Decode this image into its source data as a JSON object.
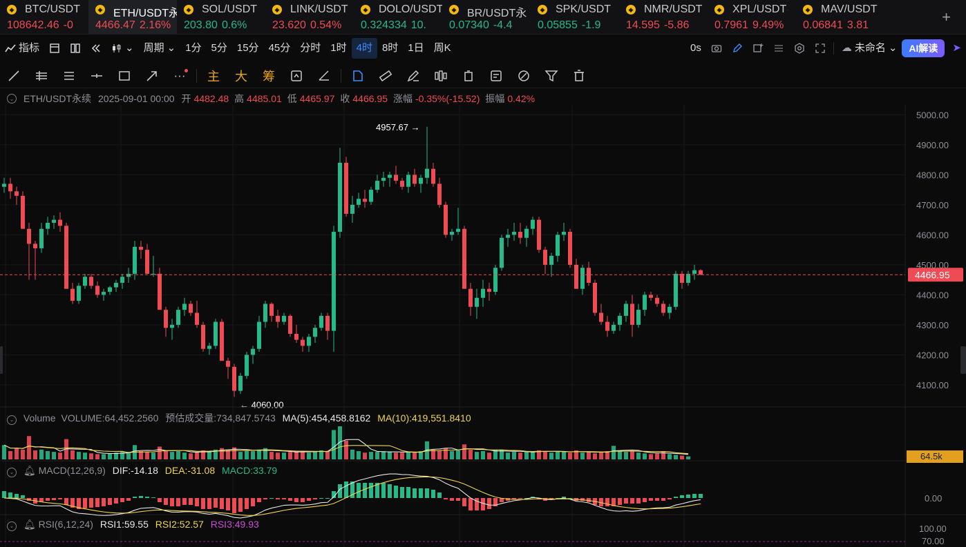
{
  "tickers": [
    {
      "symbol": "BTC/USDT",
      "price": "108642.46",
      "change": "-0",
      "dir": "dn",
      "active": false
    },
    {
      "symbol": "ETH/USDT永续",
      "price": "4466.47",
      "change": "2.16%",
      "dir": "dn",
      "active": true
    },
    {
      "symbol": "SOL/USDT",
      "price": "203.80",
      "change": "0.6%",
      "dir": "up",
      "active": false
    },
    {
      "symbol": "LINK/USDT",
      "price": "23.620",
      "change": "0.54%",
      "dir": "dn",
      "active": false
    },
    {
      "symbol": "DOLO/USDT",
      "price": "0.324334",
      "change": "10.",
      "dir": "up",
      "active": false
    },
    {
      "symbol": "BR/USDT永",
      "price": "0.07340",
      "change": "-4.4",
      "dir": "up",
      "active": false
    },
    {
      "symbol": "SPK/USDT",
      "price": "0.05855",
      "change": "-1.9",
      "dir": "up",
      "active": false
    },
    {
      "symbol": "NMR/USDT",
      "price": "14.595",
      "change": "-5.86",
      "dir": "dn",
      "active": false
    },
    {
      "symbol": "XPL/USDT",
      "price": "0.7961",
      "change": "9.49%",
      "dir": "dn",
      "active": false
    },
    {
      "symbol": "MAV/USDT",
      "price": "0.06841",
      "change": "3.81",
      "dir": "dn",
      "active": false
    }
  ],
  "toolbar": {
    "indicators_label": "指标",
    "period_label": "周期",
    "intervals": [
      "1分",
      "5分",
      "15分",
      "45分",
      "分时",
      "1时",
      "4时",
      "8时",
      "1日",
      "周K"
    ],
    "active_interval": "4时",
    "timer": "0s",
    "layout_name": "未命名",
    "ai_label": "AI解读"
  },
  "drawtools": {
    "main_label": "主",
    "big_label": "大",
    "chip_label": "筹"
  },
  "info": {
    "symbol": "ETH/USDT永续",
    "datetime": "2025-09-01 00:00",
    "open_label": "开",
    "open": "4482.48",
    "high_label": "高",
    "high": "4485.01",
    "low_label": "低",
    "low": "4465.97",
    "close_label": "收",
    "close": "4466.95",
    "change_label": "涨幅",
    "change": "-0.35%(-15.52)",
    "amp_label": "振幅",
    "amp": "0.42%"
  },
  "volume_info": {
    "name": "Volume",
    "volume": "VOLUME:64,452.2560",
    "est": "预估成交量:734,847.5743",
    "ma5": "MA(5):454,458.8162",
    "ma10": "MA(10):419,551.8410",
    "axis_label": "64.5k"
  },
  "macd_info": {
    "name": "MACD(12,26,9)",
    "dif": "DIF:-14.18",
    "dea": "DEA:-31.08",
    "macd": "MACD:33.79",
    "axis_label": "0.00"
  },
  "rsi_info": {
    "name": "RSI(6,12,24)",
    "rsi1": "RSI1:59.55",
    "rsi2": "RSI2:52.57",
    "rsi3": "RSI3:49.93",
    "axis_labels": [
      "100.00",
      "70.00"
    ]
  },
  "chart_data": {
    "type": "candlestick",
    "ylim": [
      4040,
      5040
    ],
    "yticks": [
      4100,
      4200,
      4300,
      4400,
      4500,
      4600,
      4700,
      4800,
      4900,
      5000
    ],
    "ytick_labels": [
      "4100.00",
      "4200.00",
      "4300.00",
      "4400.00",
      "4500.00",
      "4600.00",
      "4700.00",
      "4800.00",
      "4900.00",
      "5000.00"
    ],
    "last_price": 4466.95,
    "last_price_label": "4466.95",
    "high_marker": {
      "value": 4957.67,
      "label": "4957.67 →"
    },
    "low_marker": {
      "value": 4060.0,
      "label": "← 4060.00"
    },
    "candles": [
      [
        4760,
        4790,
        4740,
        4770
      ],
      [
        4770,
        4790,
        4720,
        4745
      ],
      [
        4745,
        4760,
        4700,
        4730
      ],
      [
        4730,
        4745,
        4620,
        4620
      ],
      [
        4620,
        4640,
        4450,
        4570
      ],
      [
        4570,
        4580,
        4450,
        4555
      ],
      [
        4555,
        4640,
        4540,
        4620
      ],
      [
        4620,
        4660,
        4600,
        4640
      ],
      [
        4640,
        4665,
        4620,
        4650
      ],
      [
        4650,
        4675,
        4610,
        4630
      ],
      [
        4630,
        4640,
        4420,
        4420
      ],
      [
        4420,
        4440,
        4370,
        4380
      ],
      [
        4380,
        4440,
        4370,
        4430
      ],
      [
        4430,
        4470,
        4420,
        4460
      ],
      [
        4460,
        4470,
        4420,
        4430
      ],
      [
        4430,
        4445,
        4390,
        4400
      ],
      [
        4400,
        4420,
        4380,
        4410
      ],
      [
        4410,
        4430,
        4400,
        4425
      ],
      [
        4425,
        4450,
        4410,
        4440
      ],
      [
        4440,
        4470,
        4420,
        4460
      ],
      [
        4460,
        4490,
        4440,
        4470
      ],
      [
        4470,
        4580,
        4450,
        4560
      ],
      [
        4560,
        4580,
        4520,
        4550
      ],
      [
        4550,
        4570,
        4470,
        4470
      ],
      [
        4470,
        4530,
        4460,
        4470
      ],
      [
        4470,
        4490,
        4350,
        4350
      ],
      [
        4350,
        4360,
        4260,
        4290
      ],
      [
        4290,
        4320,
        4250,
        4300
      ],
      [
        4300,
        4360,
        4290,
        4350
      ],
      [
        4350,
        4390,
        4330,
        4370
      ],
      [
        4370,
        4380,
        4330,
        4340
      ],
      [
        4340,
        4380,
        4290,
        4300
      ],
      [
        4300,
        4310,
        4210,
        4220
      ],
      [
        4220,
        4240,
        4200,
        4230
      ],
      [
        4230,
        4320,
        4220,
        4310
      ],
      [
        4310,
        4320,
        4180,
        4180
      ],
      [
        4180,
        4190,
        4120,
        4160
      ],
      [
        4160,
        4170,
        4060,
        4080
      ],
      [
        4080,
        4140,
        4070,
        4130
      ],
      [
        4130,
        4210,
        4120,
        4200
      ],
      [
        4200,
        4230,
        4170,
        4220
      ],
      [
        4220,
        4330,
        4210,
        4310
      ],
      [
        4310,
        4380,
        4290,
        4370
      ],
      [
        4370,
        4375,
        4310,
        4330
      ],
      [
        4330,
        4350,
        4290,
        4310
      ],
      [
        4310,
        4340,
        4300,
        4330
      ],
      [
        4330,
        4335,
        4260,
        4270
      ],
      [
        4270,
        4300,
        4240,
        4250
      ],
      [
        4250,
        4260,
        4210,
        4230
      ],
      [
        4230,
        4270,
        4210,
        4260
      ],
      [
        4260,
        4300,
        4240,
        4290
      ],
      [
        4290,
        4340,
        4280,
        4330
      ],
      [
        4330,
        4340,
        4250,
        4280
      ],
      [
        4280,
        4630,
        4210,
        4610
      ],
      [
        4610,
        4890,
        4590,
        4840
      ],
      [
        4840,
        4860,
        4660,
        4670
      ],
      [
        4670,
        4730,
        4640,
        4700
      ],
      [
        4700,
        4740,
        4690,
        4720
      ],
      [
        4720,
        4750,
        4690,
        4710
      ],
      [
        4710,
        4760,
        4700,
        4750
      ],
      [
        4750,
        4800,
        4740,
        4780
      ],
      [
        4780,
        4810,
        4760,
        4790
      ],
      [
        4790,
        4810,
        4760,
        4800
      ],
      [
        4800,
        4830,
        4770,
        4780
      ],
      [
        4780,
        4790,
        4750,
        4760
      ],
      [
        4760,
        4810,
        4740,
        4800
      ],
      [
        4800,
        4820,
        4760,
        4770
      ],
      [
        4770,
        4800,
        4740,
        4790
      ],
      [
        4790,
        4960,
        4770,
        4820
      ],
      [
        4820,
        4840,
        4760,
        4770
      ],
      [
        4770,
        4790,
        4690,
        4700
      ],
      [
        4700,
        4710,
        4590,
        4600
      ],
      [
        4600,
        4620,
        4580,
        4610
      ],
      [
        4610,
        4690,
        4600,
        4620
      ],
      [
        4620,
        4630,
        4420,
        4420
      ],
      [
        4420,
        4440,
        4330,
        4360
      ],
      [
        4360,
        4420,
        4320,
        4390
      ],
      [
        4390,
        4450,
        4360,
        4420
      ],
      [
        4420,
        4440,
        4380,
        4410
      ],
      [
        4410,
        4500,
        4400,
        4490
      ],
      [
        4490,
        4600,
        4480,
        4590
      ],
      [
        4590,
        4620,
        4560,
        4600
      ],
      [
        4600,
        4640,
        4580,
        4610
      ],
      [
        4610,
        4640,
        4570,
        4590
      ],
      [
        4590,
        4630,
        4560,
        4620
      ],
      [
        4620,
        4660,
        4600,
        4650
      ],
      [
        4650,
        4660,
        4540,
        4550
      ],
      [
        4550,
        4560,
        4470,
        4500
      ],
      [
        4500,
        4540,
        4460,
        4530
      ],
      [
        4530,
        4610,
        4510,
        4600
      ],
      [
        4600,
        4640,
        4580,
        4610
      ],
      [
        4610,
        4620,
        4490,
        4500
      ],
      [
        4500,
        4520,
        4420,
        4420
      ],
      [
        4420,
        4500,
        4400,
        4490
      ],
      [
        4490,
        4510,
        4430,
        4440
      ],
      [
        4440,
        4450,
        4330,
        4340
      ],
      [
        4340,
        4370,
        4300,
        4310
      ],
      [
        4310,
        4330,
        4260,
        4280
      ],
      [
        4280,
        4310,
        4270,
        4300
      ],
      [
        4300,
        4340,
        4280,
        4330
      ],
      [
        4330,
        4380,
        4310,
        4370
      ],
      [
        4370,
        4400,
        4260,
        4300
      ],
      [
        4300,
        4370,
        4290,
        4350
      ],
      [
        4350,
        4410,
        4330,
        4400
      ],
      [
        4400,
        4410,
        4380,
        4390
      ],
      [
        4390,
        4400,
        4360,
        4370
      ],
      [
        4370,
        4380,
        4330,
        4340
      ],
      [
        4340,
        4370,
        4320,
        4360
      ],
      [
        4360,
        4480,
        4350,
        4470
      ],
      [
        4470,
        4480,
        4420,
        4440
      ],
      [
        4440,
        4480,
        4430,
        4470
      ],
      [
        4470,
        4500,
        4450,
        4482
      ],
      [
        4482,
        4485,
        4466,
        4467
      ]
    ],
    "volume": [
      38,
      22,
      30,
      26,
      62,
      24,
      26,
      22,
      20,
      18,
      54,
      24,
      20,
      18,
      16,
      14,
      14,
      16,
      18,
      20,
      20,
      38,
      22,
      20,
      18,
      34,
      24,
      20,
      22,
      18,
      16,
      20,
      24,
      22,
      26,
      30,
      26,
      32,
      20,
      22,
      22,
      26,
      30,
      20,
      18,
      18,
      20,
      22,
      22,
      18,
      20,
      24,
      22,
      78,
      88,
      50,
      26,
      22,
      18,
      20,
      20,
      22,
      20,
      18,
      18,
      20,
      18,
      22,
      48,
      26,
      24,
      30,
      22,
      24,
      40,
      26,
      20,
      22,
      18,
      26,
      26,
      18,
      20,
      18,
      20,
      22,
      24,
      22,
      18,
      22,
      20,
      18,
      24,
      18,
      20,
      16,
      20,
      22,
      36,
      24,
      20,
      22,
      18,
      16,
      14,
      16,
      22,
      14,
      12,
      10,
      8
    ],
    "macd_hist": [
      10,
      8,
      6,
      4,
      -4,
      -8,
      -6,
      -4,
      -3,
      -2,
      -10,
      -14,
      -16,
      -15,
      -14,
      -13,
      -12,
      -10,
      -8,
      -6,
      -4,
      2,
      3,
      2,
      1,
      -6,
      -10,
      -12,
      -12,
      -10,
      -10,
      -12,
      -16,
      -16,
      -14,
      -16,
      -18,
      -22,
      -20,
      -16,
      -12,
      -6,
      -2,
      0,
      -2,
      -2,
      -4,
      -6,
      -6,
      -4,
      -2,
      0,
      0,
      10,
      20,
      24,
      24,
      22,
      22,
      22,
      22,
      22,
      20,
      18,
      16,
      16,
      14,
      14,
      14,
      12,
      8,
      -2,
      -4,
      -4,
      -12,
      -18,
      -18,
      -18,
      -16,
      -12,
      -6,
      -4,
      -2,
      -1,
      0,
      2,
      -2,
      -4,
      -2,
      0,
      2,
      0,
      -4,
      -4,
      -6,
      -10,
      -12,
      -12,
      -12,
      -10,
      -8,
      -8,
      -8,
      -6,
      -4,
      -4,
      -4,
      -2,
      2,
      4,
      5,
      6,
      6
    ]
  }
}
